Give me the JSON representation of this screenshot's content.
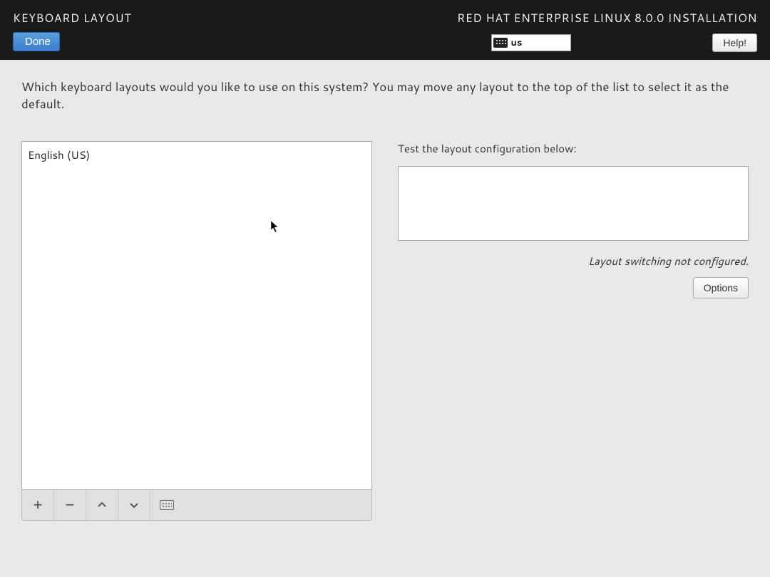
{
  "header": {
    "title": "KEYBOARD LAYOUT",
    "done_label": "Done",
    "product": "RED HAT ENTERPRISE LINUX 8.0.0 INSTALLATION",
    "layout_code": "us",
    "help_label": "Help!"
  },
  "main": {
    "instructions": "Which keyboard layouts would you like to use on this system?  You may move any layout to the top of the list to select it as the default.",
    "layouts": [
      {
        "name": "English (US)"
      }
    ],
    "test_label": "Test the layout configuration below:",
    "test_value": "",
    "switch_status": "Layout switching not configured.",
    "options_label": "Options"
  }
}
